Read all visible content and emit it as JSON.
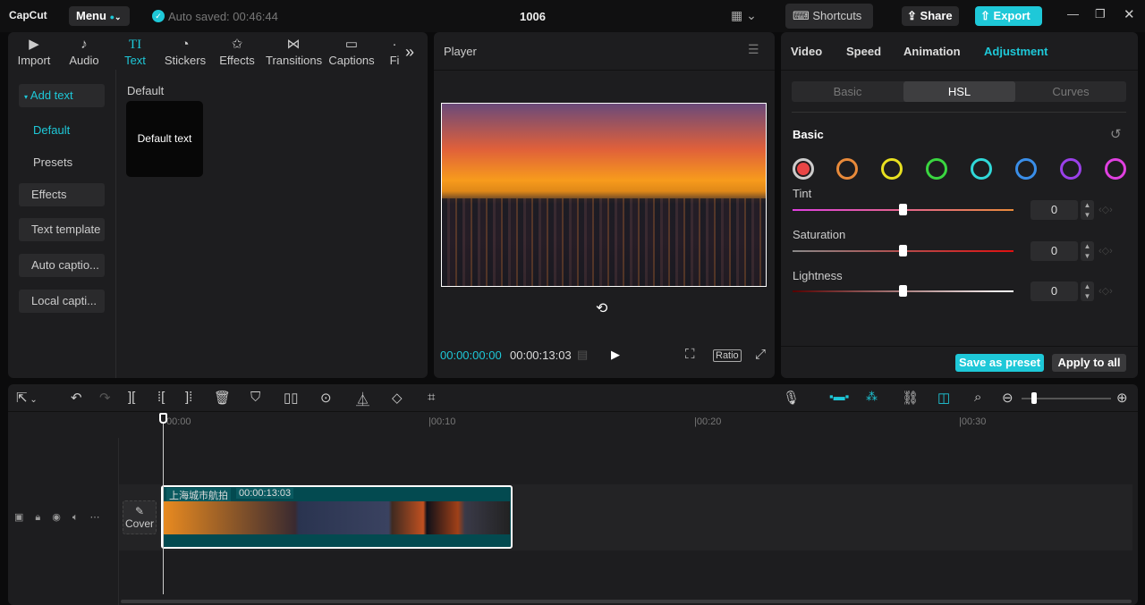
{
  "app": {
    "logo": "CapCut",
    "menu": "Menu",
    "autosave": "Auto saved: 00:46:44",
    "project_title": "1006",
    "shortcuts": "Shortcuts",
    "share": "Share",
    "export": "Export"
  },
  "media_tabs": [
    {
      "label": "Import",
      "icon": "import-icon"
    },
    {
      "label": "Audio",
      "icon": "audio-icon"
    },
    {
      "label": "Text",
      "icon": "text-icon"
    },
    {
      "label": "Stickers",
      "icon": "stickers-icon"
    },
    {
      "label": "Effects",
      "icon": "effects-icon"
    },
    {
      "label": "Transitions",
      "icon": "transitions-icon"
    },
    {
      "label": "Captions",
      "icon": "captions-icon"
    },
    {
      "label": "Fi",
      "icon": "filters-icon"
    }
  ],
  "text_sidebar": {
    "add_text": "Add text",
    "default": "Default",
    "presets": "Presets",
    "effects": "Effects",
    "text_template": "Text template",
    "auto_captions": "Auto captio...",
    "local_captions": "Local capti..."
  },
  "text_content": {
    "section": "Default",
    "card": "Default text"
  },
  "player": {
    "title": "Player",
    "current_time": "00:00:00:00",
    "total_time": "00:00:13:03",
    "ratio": "Ratio"
  },
  "inspector": {
    "tabs": [
      "Video",
      "Speed",
      "Animation",
      "Adjustment"
    ],
    "active_tab": "Adjustment",
    "subtabs": [
      "Basic",
      "HSL",
      "Curves"
    ],
    "active_subtab": "HSL",
    "section": "Basic",
    "swatches": [
      "#e84545",
      "#e88a3a",
      "#e8e020",
      "#3ad640",
      "#30d8d8",
      "#3a8ee8",
      "#9a40e8",
      "#e040e0"
    ],
    "sliders": [
      {
        "label": "Tint",
        "value": "0"
      },
      {
        "label": "Saturation",
        "value": "0"
      },
      {
        "label": "Lightness",
        "value": "0"
      }
    ],
    "save_preset": "Save as preset",
    "apply_all": "Apply to all",
    "accent": "#1ec8d8"
  },
  "timeline": {
    "ticks": [
      "00:00",
      "|00:10",
      "|00:20",
      "|00:30"
    ],
    "cover": "Cover",
    "clip_name": "上海城市航拍",
    "clip_duration": "00:00:13:03"
  }
}
